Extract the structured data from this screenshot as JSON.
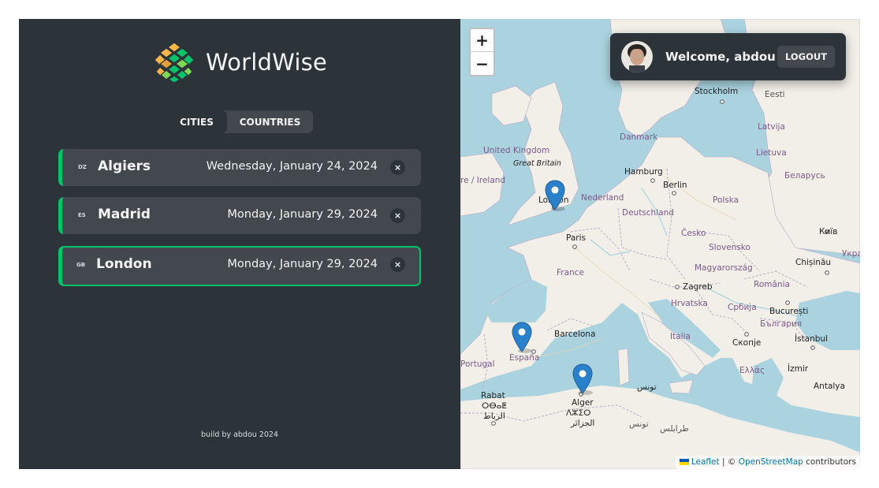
{
  "app": {
    "title": "WorldWise"
  },
  "tabs": [
    {
      "label": "Cities",
      "active": true
    },
    {
      "label": "Countries",
      "active": false
    }
  ],
  "cities": [
    {
      "code": "DZ",
      "name": "Algiers",
      "date": "Wednesday, January 24, 2024",
      "delete": "×",
      "selected": false
    },
    {
      "code": "ES",
      "name": "Madrid",
      "date": "Monday, January 29, 2024",
      "delete": "×",
      "selected": false
    },
    {
      "code": "GB",
      "name": "London",
      "date": "Monday, January 29, 2024",
      "delete": "×",
      "selected": true
    }
  ],
  "footer": "build by abdou 2024",
  "user": {
    "welcome": "Welcome, abdou",
    "logout": "Logout"
  },
  "map": {
    "zoom_in": "+",
    "zoom_out": "−",
    "labels": {
      "stockholm": "Stockholm",
      "eesti": "Eesti",
      "latvija": "Latvija",
      "danmark": "Danmark",
      "lietuva": "Lietuva",
      "united_kingdom": "United Kingdom",
      "great_britain": "Great Britain",
      "ireland": "re / Ireland",
      "hamburg": "Hamburg",
      "berlin": "Berlin",
      "belarus": "Беларусь",
      "london": "London",
      "nederland": "Nederland",
      "deutschland": "Deutschland",
      "polska": "Polska",
      "kyiv": "Київ",
      "paris": "Paris",
      "cesko": "Česko",
      "slovensko": "Slovensko",
      "ukraine": "Укра",
      "chisinau": "Chișinău",
      "france": "France",
      "magyarorszag": "Magyarország",
      "zagreb": "Zagreb",
      "romania": "România",
      "hrvatska": "Hrvatska",
      "srbija": "Србија",
      "bucuresti": "București",
      "bulgaria": "България",
      "barcelona": "Barcelona",
      "italia": "Italia",
      "skopje": "Скопје",
      "istanbul": "İstanbul",
      "portugal": "Portugal",
      "espana": "España",
      "ellas": "Ελλάς",
      "izmir": "İzmir",
      "antalya": "Antalya",
      "tunis": "تونس",
      "rabat": "Rabat",
      "rabat_tfng": "ⵔⴱⴰⵟ",
      "rabat_ar": "الرباط",
      "alger": "Alger",
      "alger_tfng": "ⴷⵣⵉⵔ",
      "alger_ar": "الجزائر",
      "tunisia": "تونس",
      "tripoli": "طرابلس"
    },
    "attribution": {
      "leaflet": "Leaflet",
      "sep": " | © ",
      "osm": "OpenStreetMap",
      "contributors": " contributors"
    }
  },
  "colors": {
    "accent": "#00c46a",
    "sidebar": "#2d3439",
    "item": "#42484d",
    "water": "#aad3df",
    "land": "#f2efe9",
    "pin": "#2a81cb"
  }
}
